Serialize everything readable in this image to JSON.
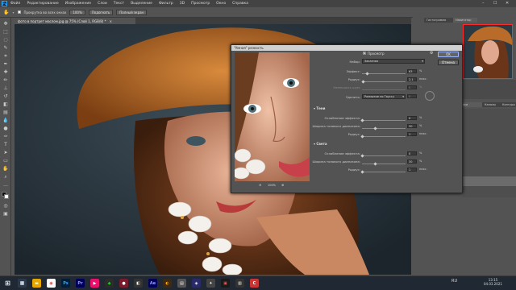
{
  "menubar": {
    "logo": "Ps",
    "items": [
      "Файл",
      "Редактирование",
      "Изображение",
      "Слои",
      "Текст",
      "Выделение",
      "Фильтр",
      "3D",
      "Просмотр",
      "Окно",
      "Справка"
    ],
    "window_controls": [
      "–",
      "☐",
      "✕"
    ]
  },
  "options": {
    "zoom_check_label": "Прокрутка во всех окнах",
    "zoom_value": "100%",
    "fit_button": "Подогнать",
    "fullscreen_button": "Полный экран"
  },
  "document": {
    "tab_title": "фото в портрет маслом.jpg @ 75% (Слой 1, RGB/8) *"
  },
  "dialog": {
    "title": "\"Умная\" резкость",
    "preview_label": "Просмотр",
    "preset_label": "Набор:",
    "preset_value": "Заказная",
    "amount_label": "Эффект:",
    "amount_value": "63",
    "amount_unit": "%",
    "amount_fraction": 0.126,
    "radius_label": "Радиус:",
    "radius_value": "2,1",
    "radius_unit": "пикс.",
    "radius_fraction": 0.033,
    "noise_label": "Уменьшить шум:",
    "noise_value": "0",
    "noise_unit": "%",
    "remove_label": "Удалить:",
    "remove_value": "Размытие по Гауссу",
    "remove_angle": "0",
    "zoom_level": "100%",
    "ok_button": "OK",
    "cancel_button": "Отмена",
    "shadows": {
      "title": "Тени",
      "fade_label": "Ослабление эффекта:",
      "fade_value": "0",
      "fade_unit": "%",
      "fade_fraction": 0.0,
      "tonal_label": "Ширина тонового диапазона:",
      "tonal_value": "30",
      "tonal_unit": "%",
      "tonal_fraction": 0.3,
      "radius_label": "Радиус:",
      "radius_value": "1",
      "radius_unit": "пикс.",
      "radius_fraction": 0.01
    },
    "highlights": {
      "title": "Света",
      "fade_label": "Ослабление эффекта:",
      "fade_value": "0",
      "fade_unit": "%",
      "fade_fraction": 0.0,
      "tonal_label": "Ширина тонового диапазона:",
      "tonal_value": "30",
      "tonal_unit": "%",
      "tonal_fraction": 0.3,
      "radius_label": "Радиус:",
      "radius_value": "1",
      "radius_unit": "пикс.",
      "radius_fraction": 0.01
    }
  },
  "right_panel": {
    "tab_histogram": "Гистограмма",
    "tab_navigator": "Навигатор",
    "tab_layers": "Слои",
    "tab_channels": "Каналы",
    "tab_paths": "Контуры"
  },
  "status": {
    "zoom": "75,09%",
    "doc_size": "Док: 1,53M/3,06M"
  },
  "taskbar": {
    "time": "13:15",
    "date": "04.03.2021",
    "lang": "RU"
  }
}
